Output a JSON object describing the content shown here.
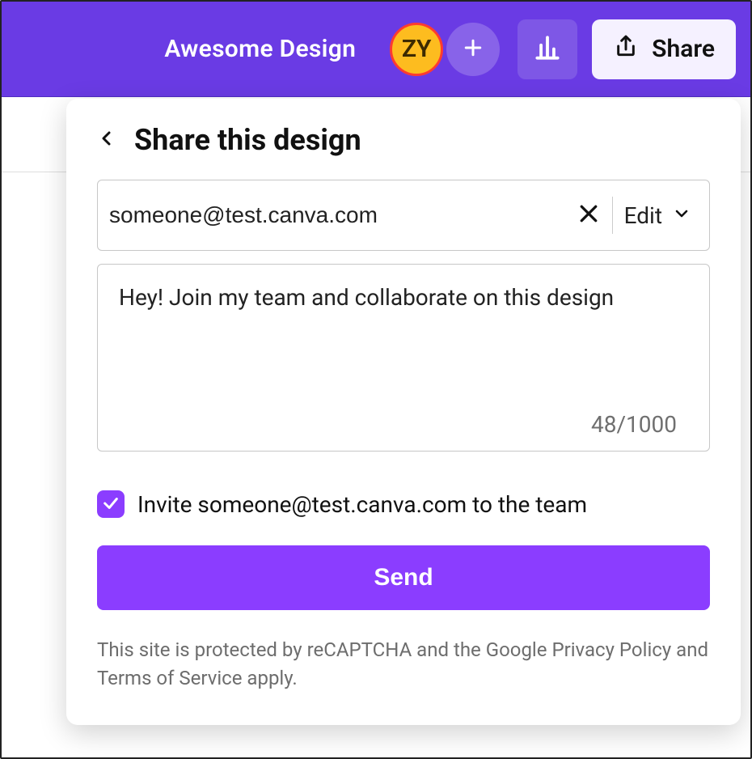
{
  "header": {
    "design_title": "Awesome Design",
    "avatar_initials": "ZY",
    "share_label": "Share"
  },
  "panel": {
    "title": "Share this design",
    "recipient_value": "someone@test.canva.com",
    "permission_label": "Edit",
    "message_value": "Hey! Join my team and collaborate on this design",
    "counter": "48/1000",
    "invite_checked": true,
    "invite_label": "Invite someone@test.canva.com to the team",
    "send_label": "Send",
    "legal_text": "This site is protected by reCAPTCHA and the Google Privacy Policy and Terms of Service apply."
  }
}
